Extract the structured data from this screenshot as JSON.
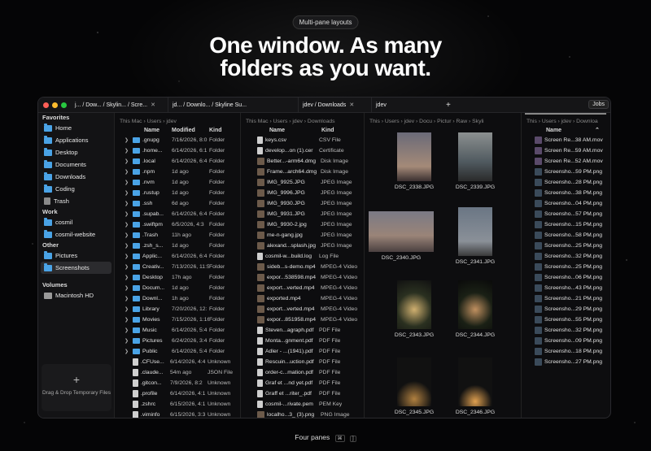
{
  "badge": "Multi-pane layouts",
  "headline1": "One window. As many",
  "headline2": "folders as you want.",
  "bottom": {
    "label": "Four panes",
    "key1": "⌘",
    "key2": "]"
  },
  "tabs": [
    {
      "label": "j... / Dow... / Skylin... / Scre..."
    },
    {
      "label": "jd... / Downlo... / Skyline Su..."
    },
    {
      "label": "jdev / Downloads"
    },
    {
      "label": "jdev"
    }
  ],
  "jobs": "Jobs",
  "sidebar": {
    "favorites": "Favorites",
    "fav_items": [
      "Home",
      "Applications",
      "Desktop",
      "Documents",
      "Downloads",
      "Coding",
      "Trash"
    ],
    "work": "Work",
    "work_items": [
      "cosmil",
      "cosmil-website"
    ],
    "other": "Other",
    "other_items": [
      "Pictures",
      "Screenshots"
    ],
    "volumes": "Volumes",
    "volume_items": [
      "Macintosh HD"
    ],
    "drop": "Drag & Drop Temporary Files"
  },
  "pane1": {
    "crumb": "This Mac  ›  Users  ›  jdev",
    "h_name": "Name",
    "h_mod": "Modified",
    "h_kind": "Kind",
    "rows": [
      [
        ".gnupg",
        "7/16/2026, 8:0",
        "Folder"
      ],
      [
        ".home...",
        "6/14/2026, 6:1",
        "Folder"
      ],
      [
        ".local",
        "6/14/2026, 6:4",
        "Folder"
      ],
      [
        ".npm",
        "1d ago",
        "Folder"
      ],
      [
        ".nvm",
        "1d ago",
        "Folder"
      ],
      [
        ".rustup",
        "1d ago",
        "Folder"
      ],
      [
        ".ssh",
        "6d ago",
        "Folder"
      ],
      [
        ".supab...",
        "6/14/2026, 6:4",
        "Folder"
      ],
      [
        ".swiftpm",
        "6/5/2026, 4:3",
        "Folder"
      ],
      [
        ".Trash",
        "11h ago",
        "Folder"
      ],
      [
        ".zsh_s...",
        "1d ago",
        "Folder"
      ],
      [
        "Applic...",
        "6/14/2026, 6:4",
        "Folder"
      ],
      [
        "Creativ...",
        "7/13/2026, 11:5",
        "Folder"
      ],
      [
        "Desktop",
        "17h ago",
        "Folder"
      ],
      [
        "Docum...",
        "1d ago",
        "Folder"
      ],
      [
        "Downl...",
        "1h ago",
        "Folder"
      ],
      [
        "Library",
        "7/20/2026, 12:",
        "Folder"
      ],
      [
        "Movies",
        "7/15/2026, 1:16",
        "Folder"
      ],
      [
        "Music",
        "6/14/2026, 5:4",
        "Folder"
      ],
      [
        "Pictures",
        "6/24/2026, 3:4",
        "Folder"
      ],
      [
        "Public",
        "6/14/2026, 5:4",
        "Folder"
      ],
      [
        ".CFUse...",
        "6/14/2026, 4:4",
        "Unknown"
      ],
      [
        ".claude...",
        "54m ago",
        "JSON File"
      ],
      [
        ".gitcon...",
        "7/9/2026, 8:2",
        "Unknown"
      ],
      [
        ".profile",
        "6/14/2026, 4:1",
        "Unknown"
      ],
      [
        ".zshrc",
        "6/15/2026, 4:1",
        "Unknown"
      ],
      [
        ".viminfo",
        "6/15/2026, 3:3",
        "Unknown"
      ]
    ]
  },
  "pane2": {
    "crumb": "This Mac  ›  Users  ›  jdev  ›  Downloads",
    "h_name": "Name",
    "h_kind": "Kind",
    "rows": [
      [
        "keys.csv",
        "CSV File"
      ],
      [
        "develop...on (1).cer",
        "Certificate"
      ],
      [
        "Better...-arm64.dmg",
        "Disk Image"
      ],
      [
        "Frame...arch64.dmg",
        "Disk Image"
      ],
      [
        "IMG_9925.JPG",
        "JPEG Image"
      ],
      [
        "IMG_9996.JPG",
        "JPEG Image"
      ],
      [
        "IMG_9930.JPG",
        "JPEG Image"
      ],
      [
        "IMG_9931.JPG",
        "JPEG Image"
      ],
      [
        "IMG_9930-2.jpg",
        "JPEG Image"
      ],
      [
        "me-n-gang.jpg",
        "JPEG Image"
      ],
      [
        "alexand...splash.jpg",
        "JPEG Image"
      ],
      [
        "cosmil-w...build.log",
        "Log File"
      ],
      [
        "sideb...s-demo.mp4",
        "MPEG-4 Video"
      ],
      [
        "expor...538598.mp4",
        "MPEG-4 Video"
      ],
      [
        "export...verted.mp4",
        "MPEG-4 Video"
      ],
      [
        "exported.mp4",
        "MPEG-4 Video"
      ],
      [
        "export...verted.mp4",
        "MPEG-4 Video"
      ],
      [
        "expor...851958.mp4",
        "MPEG-4 Video"
      ],
      [
        "Steven...agraph.pdf",
        "PDF File"
      ],
      [
        "Monta...gnment.pdf",
        "PDF File"
      ],
      [
        "Adler - ...(1941).pdf",
        "PDF File"
      ],
      [
        "Rescuin...uction.pdf",
        "PDF File"
      ],
      [
        "order-c...mation.pdf",
        "PDF File"
      ],
      [
        "Graf et ...nd yet.pdf",
        "PDF File"
      ],
      [
        "Graff et ...riter_.pdf",
        "PDF File"
      ],
      [
        "cosmil-...rivate.pem",
        "PEM Key"
      ],
      [
        "localho...3_ (3).png",
        "PNG Image"
      ]
    ]
  },
  "pane3": {
    "crumb": "This  ›  Users  ›  jdev  ›  Docu  ›  Pictur  ›  Raw  ›  Skyli",
    "items": [
      "DSC_2338.JPG",
      "DSC_2339.JPG",
      "DSC_2340.JPG",
      "DSC_2341.JPG",
      "DSC_2343.JPG",
      "DSC_2344.JPG",
      "DSC_2345.JPG",
      "DSC_2346.JPG"
    ]
  },
  "pane4": {
    "crumb": "This  ›  Users  ›  jdev  ›  Downloa",
    "h_name": "Name",
    "rows": [
      "Screen Re...38 AM.mov",
      "Screen Re...59 AM.mov",
      "Screen Re...52 AM.mov",
      "Screensho...59 PM.png",
      "Screensho...28 PM.png",
      "Screensho...38 PM.png",
      "Screensho...04 PM.png",
      "Screensho...57 PM.png",
      "Screensho...15 PM.png",
      "Screensho...58 PM.png",
      "Screensho...25 PM.png",
      "Screensho...32 PM.png",
      "Screensho...25 PM.png",
      "Screensho...06 PM.png",
      "Screensho...43 PM.png",
      "Screensho...21 PM.png",
      "Screensho...29 PM.png",
      "Screensho...55 PM.png",
      "Screensho...32 PM.png",
      "Screensho...09 PM.png",
      "Screensho...18 PM.png",
      "Screensho...27 PM.png"
    ]
  }
}
